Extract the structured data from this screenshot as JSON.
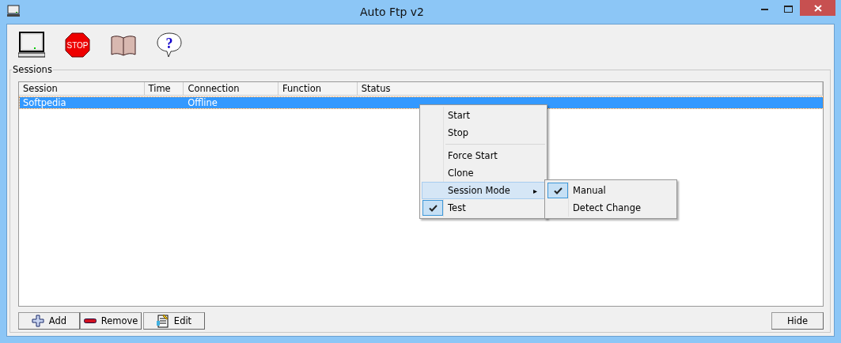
{
  "window": {
    "title": "Auto Ftp v2"
  },
  "toolbar": {
    "stop_label": "STOP",
    "help_label": "?"
  },
  "sessions": {
    "label": "Sessions",
    "columns": [
      "Session",
      "Time",
      "Connection",
      "Function",
      "Status"
    ],
    "rows": [
      {
        "cells": [
          "Softpedia",
          null,
          "Offline",
          null,
          null
        ],
        "selected": true
      }
    ]
  },
  "context_menu": {
    "items": [
      {
        "kind": "item",
        "label": "Start",
        "checked": false,
        "highlighted": false
      },
      {
        "kind": "item",
        "label": "Stop",
        "checked": false,
        "highlighted": false
      },
      {
        "kind": "separator"
      },
      {
        "kind": "item",
        "label": "Force Start",
        "checked": false,
        "highlighted": false
      },
      {
        "kind": "item",
        "label": "Clone",
        "checked": false,
        "highlighted": false
      },
      {
        "kind": "submenu",
        "label": "Session Mode",
        "checked": false,
        "highlighted": true,
        "arrow": "▸",
        "items": [
          {
            "kind": "item",
            "label": "Manual",
            "checked": true,
            "highlighted": false
          },
          {
            "kind": "item",
            "label": "Detect Change",
            "checked": false,
            "highlighted": false
          }
        ]
      },
      {
        "kind": "item",
        "label": "Test",
        "checked": true,
        "highlighted": false
      }
    ]
  },
  "buttons": [
    {
      "kind": "add",
      "label": "Add"
    },
    {
      "kind": "remove",
      "label": "Remove"
    },
    {
      "kind": "edit",
      "label": "Edit"
    }
  ],
  "hide_button": {
    "label": "Hide"
  }
}
